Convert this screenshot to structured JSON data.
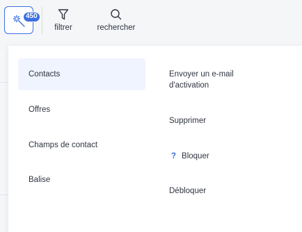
{
  "toolbar": {
    "magic_badge": "450",
    "filter_label": "filtrer",
    "search_label": "rechercher"
  },
  "menu": {
    "categories": [
      {
        "label": "Contacts",
        "active": true
      },
      {
        "label": "Offres",
        "active": false
      },
      {
        "label": "Champs de contact",
        "active": false
      },
      {
        "label": "Balise",
        "active": false
      }
    ],
    "actions": [
      {
        "label": "Envoyer un e-mail d'activation"
      },
      {
        "label": "Supprimer"
      },
      {
        "label": "Bloquer",
        "icon": "?"
      },
      {
        "label": "Débloquer"
      }
    ]
  },
  "colors": {
    "accent": "#3b6fe0",
    "active_bg": "#f0f4fe",
    "text": "#2f3440",
    "page_bg": "#f5f6f8"
  }
}
